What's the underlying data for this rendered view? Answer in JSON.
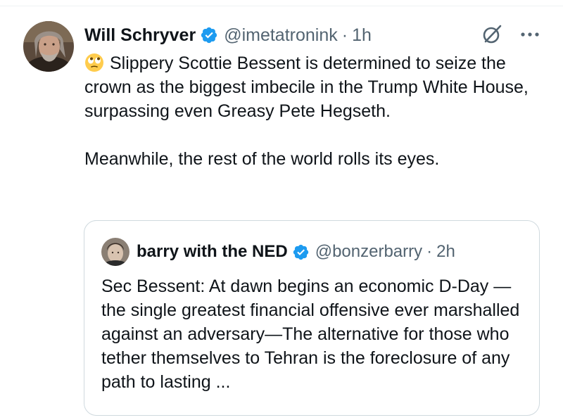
{
  "tweet": {
    "display_name": "Will Schryver",
    "handle": "@imetatronink",
    "separator": "·",
    "time": "1h",
    "emoji_icon": "face-with-rolling-eyes-icon",
    "text_line_1": "Slippery Scottie Bessent is determined to seize the crown as the biggest imbecile in the Trump White House, surpassing even Greasy Pete Hegseth.",
    "text_line_2": "Meanwhile, the rest of the world rolls its eyes."
  },
  "quoted_tweet": {
    "display_name": "barry with the NED",
    "handle": "@bonzerbarry",
    "separator": "·",
    "time": "2h",
    "text": "Sec Bessent: At dawn begins an economic D-Day — the single greatest financial offensive ever marshalled against an adversary—The alternative for those who tether themselves to Tehran is the foreclosure of any path to lasting ..."
  },
  "icons": {
    "verified": "verified-badge-icon",
    "grok": "grok-icon",
    "more": "more-options-icon"
  },
  "colors": {
    "verified_blue": "#1d9bf0",
    "text_primary": "#0f1419",
    "text_secondary": "#536471",
    "border": "#cfd9de"
  }
}
